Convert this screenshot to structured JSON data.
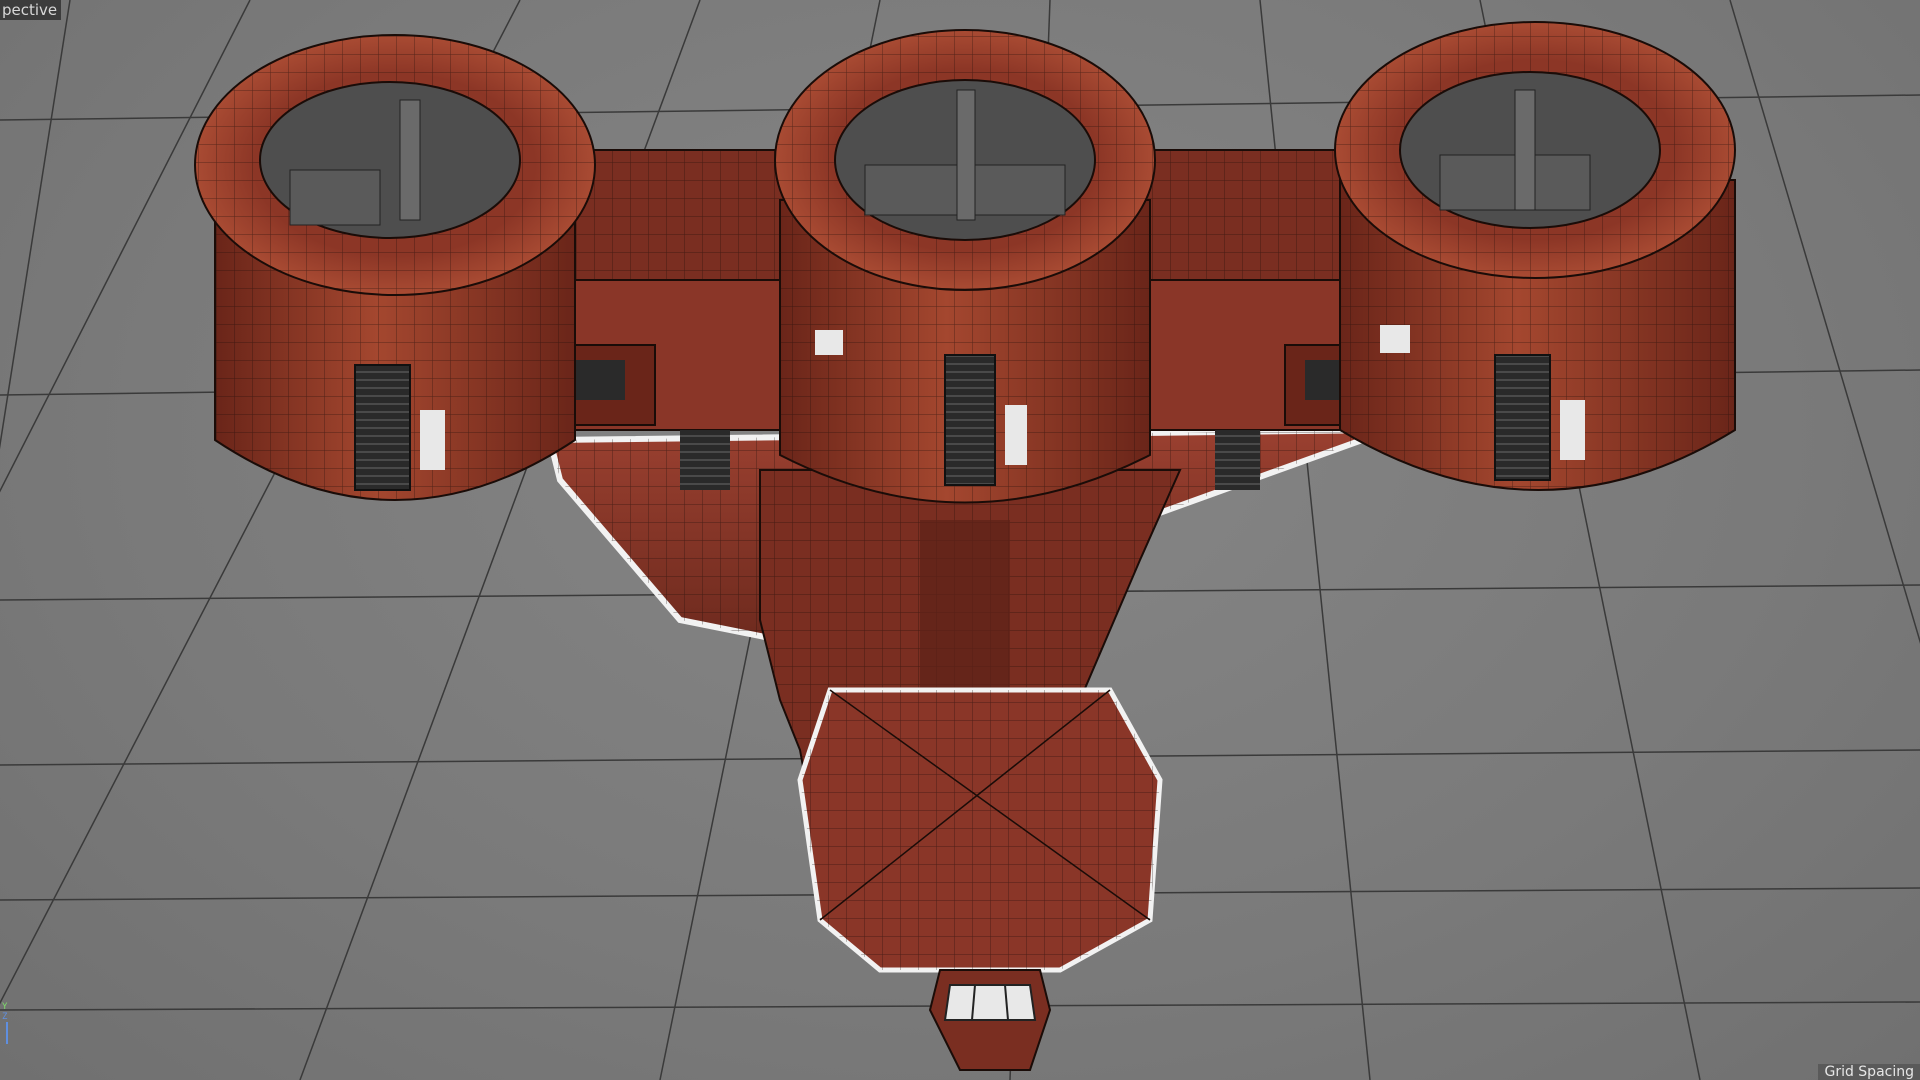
{
  "viewport": {
    "view_label": "pective",
    "grid_spacing_label": "Grid Spacing",
    "axis_labels": [
      "Y",
      "Z"
    ],
    "colors": {
      "background": "#7d7d7d",
      "grid_line": "#3a3a3a",
      "hull_red": "#8a3628",
      "hull_dark": "#5a2016",
      "wireframe": "#1a0c08",
      "engine_interior": "#5a5a5a"
    },
    "model": {
      "description_icon": "spaceship-model-icon",
      "engine_count": 3
    }
  }
}
